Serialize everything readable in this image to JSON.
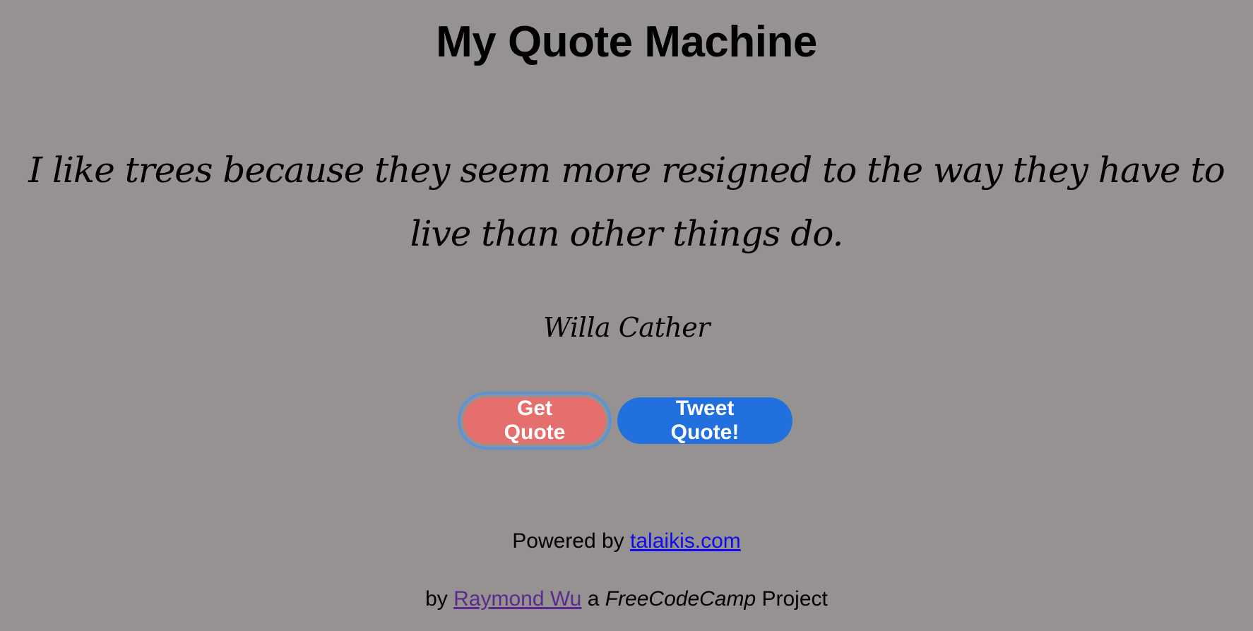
{
  "header": {
    "title": "My Quote Machine"
  },
  "quote": {
    "text": "I like trees because they seem more resigned to the way they have to live than other things do.",
    "author": "Willa Cather"
  },
  "buttons": {
    "get_quote_label": "Get Quote",
    "tweet_quote_label": "Tweet Quote!"
  },
  "colors": {
    "background": "#969291",
    "get_quote_button": "#e56f6c",
    "tweet_button": "#2270de",
    "focus_ring": "#5b93d9",
    "link_unvisited": "#0d0df0",
    "link_visited": "#5b2a8f"
  },
  "footer": {
    "powered_prefix": "Powered by",
    "powered_link": "talaikis.com",
    "by_prefix": "by",
    "author_link": "Raymond Wu",
    "a_word": "a",
    "freecodecamp": "FreeCodeCamp",
    "project_word": "Project"
  }
}
